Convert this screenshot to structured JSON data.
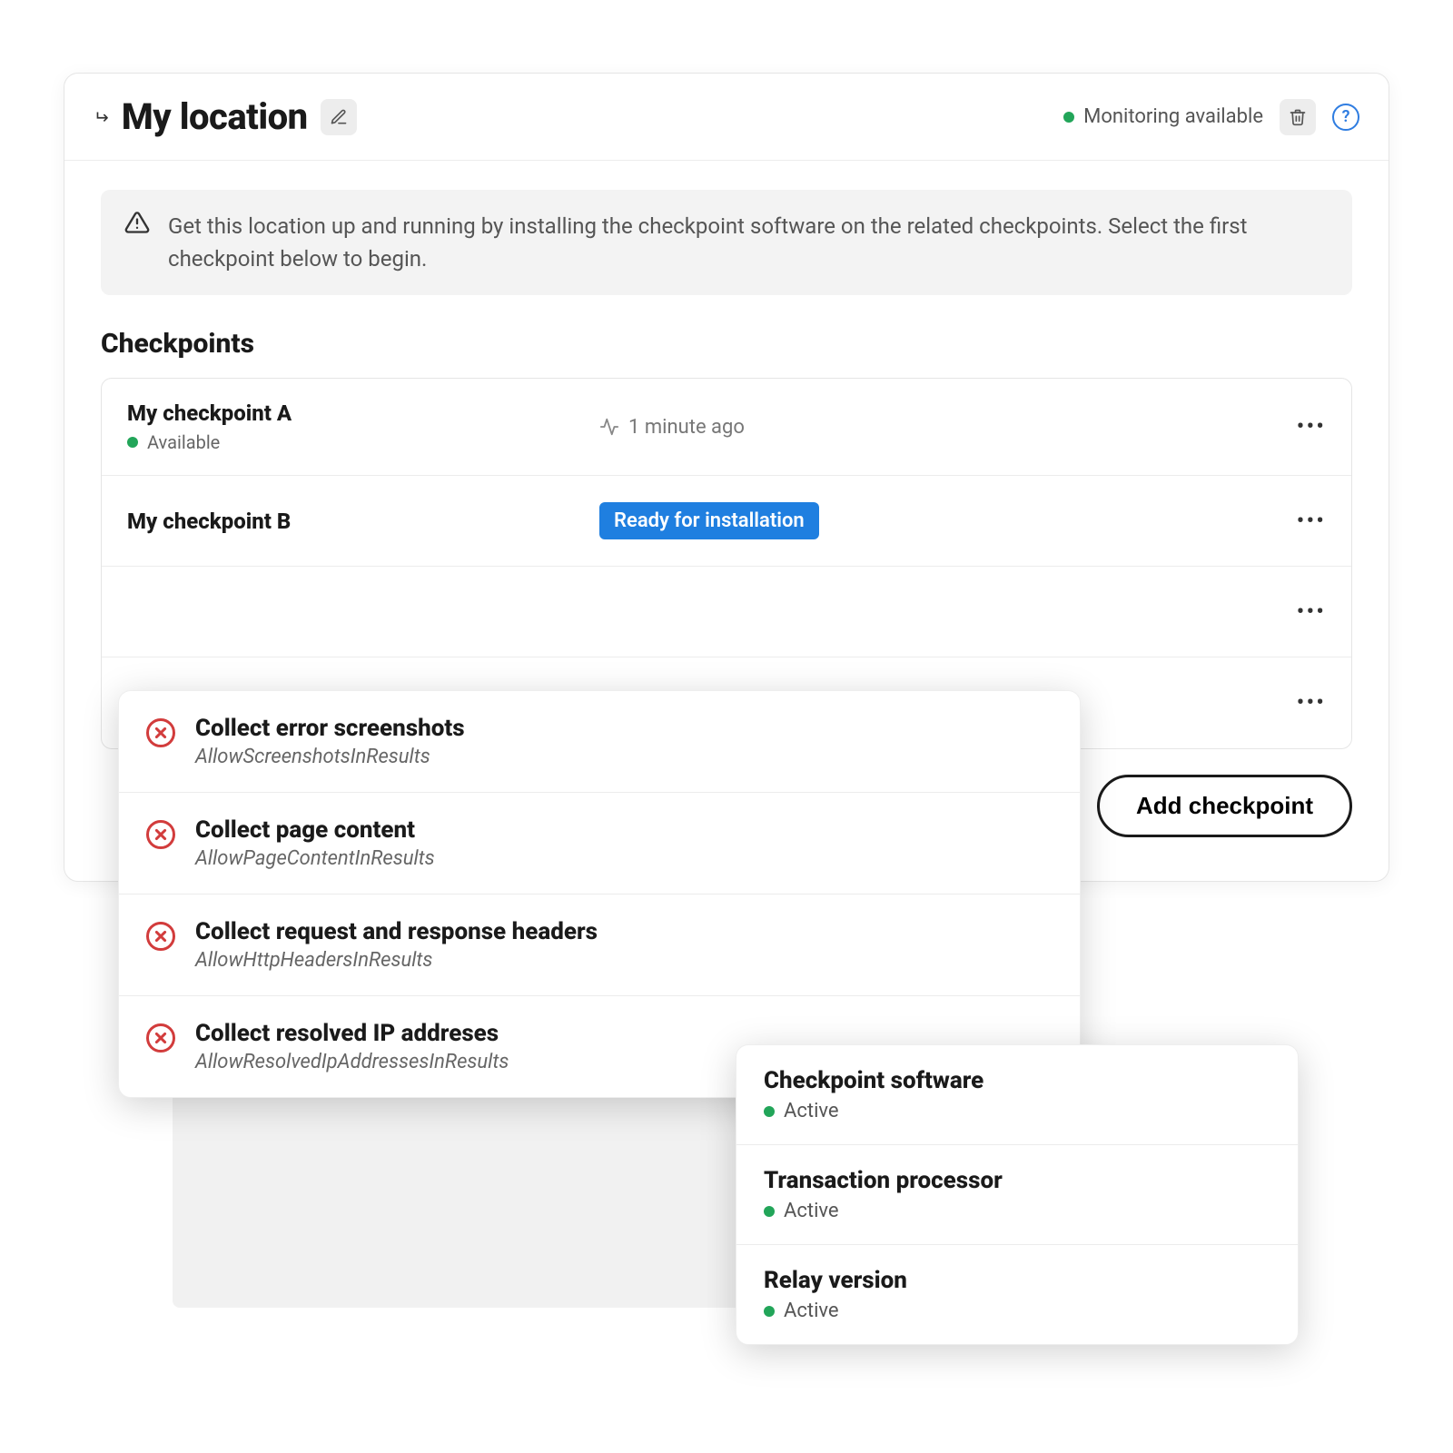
{
  "header": {
    "title": "My location",
    "status_label": "Monitoring available"
  },
  "banner": {
    "text": "Get this location up and running by installing the checkpoint software on the related checkpoints. Select the first checkpoint below to begin."
  },
  "section": {
    "title": "Checkpoints"
  },
  "checkpoints": [
    {
      "name": "My checkpoint A",
      "status": "Available",
      "time": "1 minute ago",
      "badge": ""
    },
    {
      "name": "My checkpoint B",
      "status": "",
      "time": "",
      "badge": "Ready for installation"
    },
    {
      "name": "",
      "status": "",
      "time": "",
      "badge": ""
    },
    {
      "name": "",
      "status": "",
      "time": "",
      "badge": ""
    }
  ],
  "add_button_label": "Add checkpoint",
  "collect_popover": [
    {
      "title": "Collect error screenshots",
      "key": "AllowScreenshotsInResults"
    },
    {
      "title": "Collect page content",
      "key": "AllowPageContentInResults"
    },
    {
      "title": "Collect request and response headers",
      "key": "AllowHttpHeadersInResults"
    },
    {
      "title": "Collect resolved IP addreses",
      "key": "AllowResolvedIpAddressesInResults"
    }
  ],
  "status_popover": [
    {
      "title": "Checkpoint software",
      "status": "Active"
    },
    {
      "title": "Transaction processor",
      "status": "Active"
    },
    {
      "title": "Relay version",
      "status": "Active"
    }
  ]
}
